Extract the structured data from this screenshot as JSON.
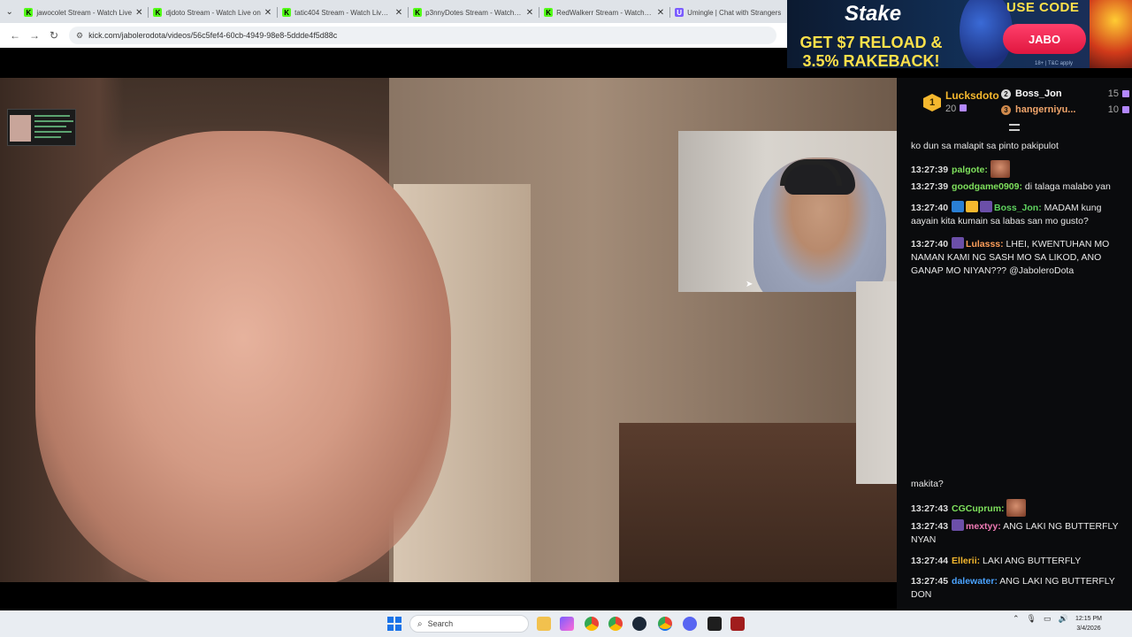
{
  "browser": {
    "tabs": [
      {
        "title": "jawocolet Stream - Watch Live",
        "favicon": "K"
      },
      {
        "title": "djdoto Stream - Watch Live on",
        "favicon": "K"
      },
      {
        "title": "tatic404 Stream - Watch Live on",
        "favicon": "K"
      },
      {
        "title": "p3nnyDotes Stream - Watch Live",
        "favicon": "K"
      },
      {
        "title": "RedWalkerr Stream - Watch Live",
        "favicon": "K"
      },
      {
        "title": "Umingle | Chat with Strangers",
        "favicon": "U"
      }
    ],
    "url": "kick.com/jabolerodota/videos/56c5fef4-60cb-4949-98e8-5ddde4f5d88c"
  },
  "ad": {
    "brand": "Stake",
    "headline_line1": "GET $7 RELOAD &",
    "headline_line2": "3.5% RAKEBACK!",
    "use_code": "USE CODE",
    "code": "JABO",
    "disclaimer": "18+ | T&C apply"
  },
  "leaderboard": {
    "first": {
      "rank": "1",
      "name": "Lucksdoto",
      "count": "20"
    },
    "second": {
      "rank": "2",
      "name": "Boss_Jon",
      "count": "15"
    },
    "third": {
      "rank": "3",
      "name": "hangerniyu...",
      "count": "10"
    }
  },
  "chat": {
    "messages": [
      {
        "time": "",
        "user": "",
        "text": "ko dun sa malapit sa pinto pakipulot",
        "color": "#e8e8e8"
      },
      {
        "time": "13:27:39",
        "user": "palgote:",
        "text": "",
        "color": "#7ee05c",
        "emote": true
      },
      {
        "time": "13:27:39",
        "user": "goodgame0909:",
        "text": " di talaga malabo yan",
        "color": "#7ee05c"
      },
      {
        "time": "13:27:40",
        "user": "Boss_Jon:",
        "text": " MADAM kung aayain kita kumain sa labas san mo gusto?",
        "color": "#5fd35f",
        "badges": 3
      },
      {
        "time": "13:27:40",
        "user": "Lulasss:",
        "text": " LHEI, KWENTUHAN MO NAMAN KAMI NG SASH MO SA LIKOD, ANO GANAP MO NIYAN??? @JaboleroDota",
        "color": "#ff9f5a",
        "badges": 1
      },
      {
        "time": "",
        "user": "",
        "text": "makita?",
        "color": "#e8e8e8"
      },
      {
        "time": "13:27:43",
        "user": "CGCuprum:",
        "text": "",
        "color": "#7ee05c",
        "emote": true
      },
      {
        "time": "13:27:43",
        "user": "mextyy:",
        "text": " ANG LAKI NG BUTTERFLY NYAN",
        "color": "#f07ab5",
        "badges": 1
      },
      {
        "time": "13:27:44",
        "user": "Ellerii:",
        "text": " LAKI ANG BUTTERFLY",
        "color": "#f5b82e"
      },
      {
        "time": "13:27:45",
        "user": "dalewater:",
        "text": " ANG LAKI NG BUTTERFLY DON",
        "color": "#4aa3ff"
      }
    ]
  },
  "taskbar": {
    "search_label": "Search",
    "time": "12:15 PM",
    "date": "3/4/2026"
  },
  "colors": {
    "kick_green": "#53fc18",
    "ad_yellow": "#ffe14a",
    "ad_button": "#e0173f"
  }
}
